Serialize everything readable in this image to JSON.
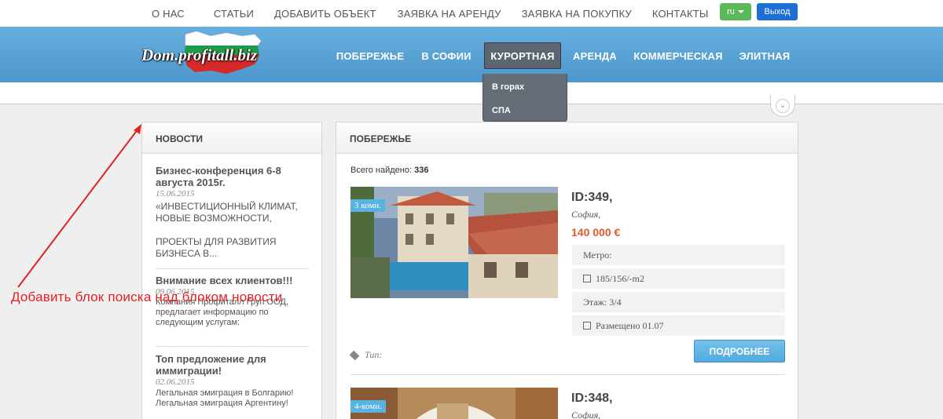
{
  "topnav": {
    "links": [
      "О НАС",
      "СТАТЬИ",
      "ДОБАВИТЬ ОБЪЕКТ",
      "ЗАЯВКА НА АРЕНДУ",
      "ЗАЯВКА НА ПОКУПКУ",
      "КОНТАКТЫ"
    ],
    "lang": "ru",
    "exit": "Выход"
  },
  "logo": {
    "text": "Dom.profitall.biz"
  },
  "mainnav": {
    "items": [
      "ПОБЕРЕЖЬЕ",
      "В СОФИИ",
      "КУРОРТНАЯ",
      "АРЕНДА",
      "КОММЕРЧЕСКАЯ",
      "ЭЛИТНАЯ"
    ],
    "active": "КУРОРТНАЯ",
    "dropdown": [
      "В горах",
      "СПА"
    ]
  },
  "news": {
    "title": "НОВОСТИ",
    "items": [
      {
        "title": "Бизнес-конференция 6-8 августа 2015г.",
        "date": "15.06.2015",
        "text": "«ИНВЕСТИЦИОННЫЙ КЛИМАТ, НОВЫЕ ВОЗМОЖНОСТИ,\n\nПРОЕКТЫ ДЛЯ РАЗВИТИЯ БИЗНЕСА В..."
      },
      {
        "title": "Внимание всех клиентов!!!",
        "date": "09.06.2015",
        "text": "Компания Профиталл Груп ООД, предлагает информацию по следующим услугам:"
      },
      {
        "title": "Топ предложение для иммиграции!",
        "date": "02.06.2015",
        "text": "Легальная  эмиграция в Болгарию! Легальная эмиграция  Аргентину!"
      }
    ]
  },
  "listings": {
    "title": "ПОБЕРЕЖЬЕ",
    "found_label": "Всего найдено:",
    "found_count": "336",
    "items": [
      {
        "badge": "3 комн.",
        "id": "ID:349,",
        "city": "София,",
        "price": "140 000 €",
        "metro": "Метро:",
        "area": "185/156/-m2",
        "floor": "Этаж: 3/4",
        "posted": "Размещено 01.07",
        "type": "Тип:",
        "button": "ПОДРОБНЕЕ"
      },
      {
        "badge": "4-комн.",
        "id": "ID:348,",
        "city": "София,"
      }
    ]
  },
  "annotation": {
    "text": "Добавить блок поиска над блоком новости",
    "color": "#e32222"
  }
}
